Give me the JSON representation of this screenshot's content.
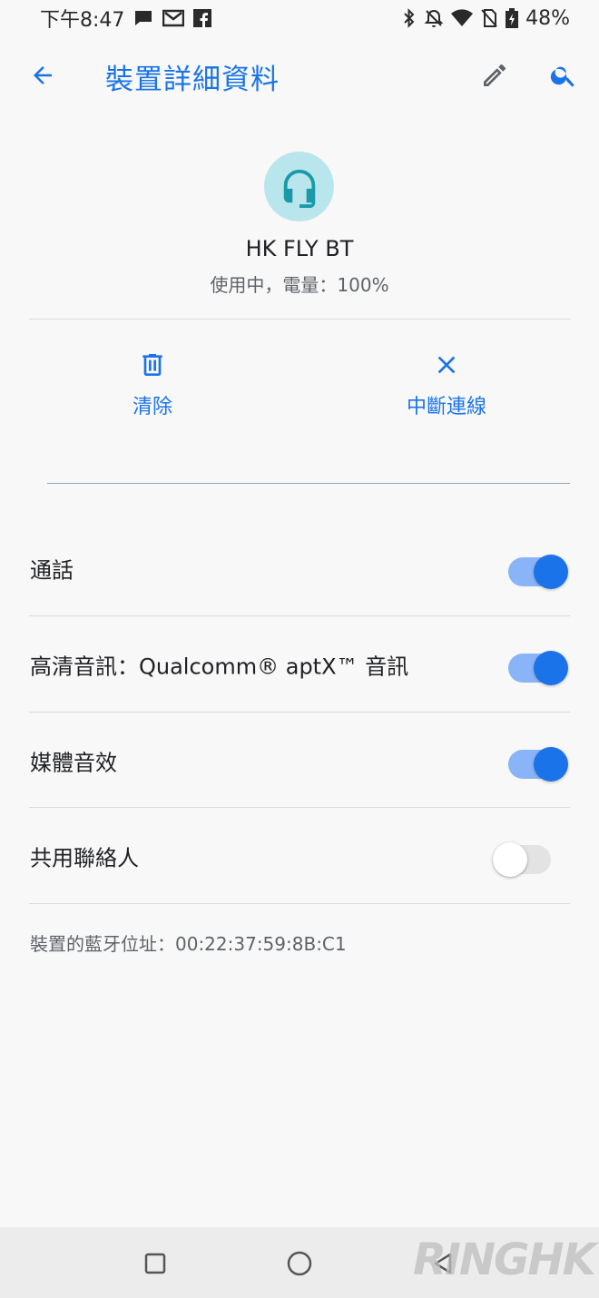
{
  "status_bar": {
    "time": "下午8:47",
    "battery": "48%",
    "icons_left": [
      "message-icon",
      "gmail-icon",
      "facebook-icon"
    ],
    "icons_right": [
      "bluetooth-icon",
      "notifications-off-icon",
      "wifi-icon",
      "no-sim-icon",
      "battery-charging-icon"
    ]
  },
  "app_bar": {
    "title": "裝置詳細資料",
    "accent": "#1a73e8"
  },
  "device": {
    "name": "HK FLY BT",
    "status": "使用中，電量：100%",
    "icon": "headset-icon",
    "icon_bg": "#b9e6ec",
    "icon_color": "#1a9aa8"
  },
  "actions": [
    {
      "label": "清除",
      "icon": "trash-icon"
    },
    {
      "label": "中斷連線",
      "icon": "close-icon"
    }
  ],
  "settings": [
    {
      "label": "通話",
      "enabled": true
    },
    {
      "label": "高清音訊：Qualcomm® aptX™ 音訊",
      "enabled": true
    },
    {
      "label": "媒體音效",
      "enabled": true
    },
    {
      "label": "共用聯絡人",
      "enabled": false
    }
  ],
  "address": "裝置的藍牙位址：00:22:37:59:8B:C1",
  "nav_bar": {
    "buttons": [
      "recents-square-icon",
      "home-circle-icon",
      "back-triangle-icon"
    ]
  },
  "watermark": "RINGHK"
}
